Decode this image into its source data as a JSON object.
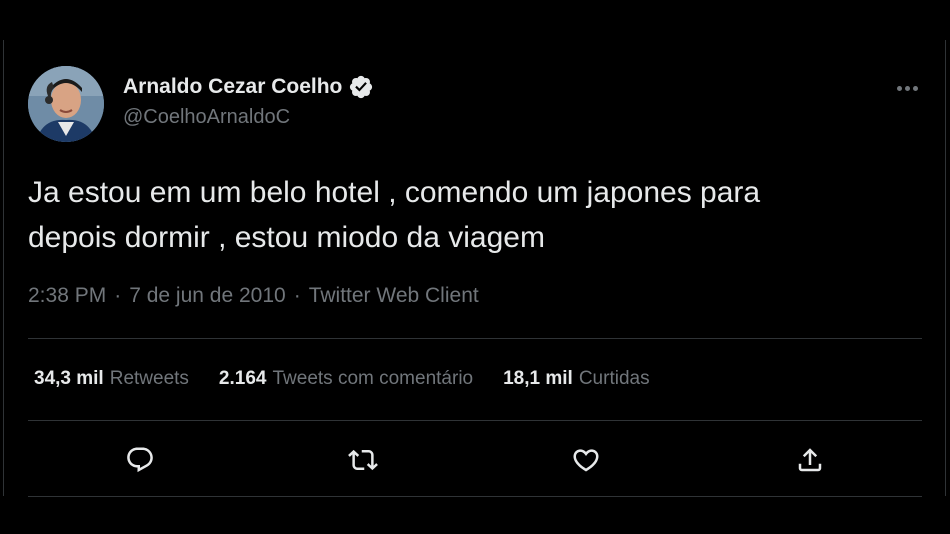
{
  "author": {
    "name": "Arnaldo Cezar Coelho",
    "handle": "@CoelhoArnaldoC",
    "verified": true
  },
  "tweet": {
    "text": "Ja estou em um belo hotel , comendo um japones para\ndepois dormir , estou miodo da viagem",
    "time": "2:38 PM",
    "date": "7 de jun de 2010",
    "source": "Twitter Web Client",
    "separator": "·"
  },
  "stats": {
    "retweets": {
      "count": "34,3 mil",
      "label": "Retweets"
    },
    "quotes": {
      "count": "2.164",
      "label": "Tweets com comentário"
    },
    "likes": {
      "count": "18,1 mil",
      "label": "Curtidas"
    }
  },
  "actions": {
    "reply": "reply-icon",
    "retweet": "retweet-icon",
    "like": "heart-icon",
    "share": "share-icon"
  },
  "colors": {
    "background": "#000000",
    "text": "#e7e9ea",
    "secondary": "#71767b",
    "border": "#2f3336"
  }
}
